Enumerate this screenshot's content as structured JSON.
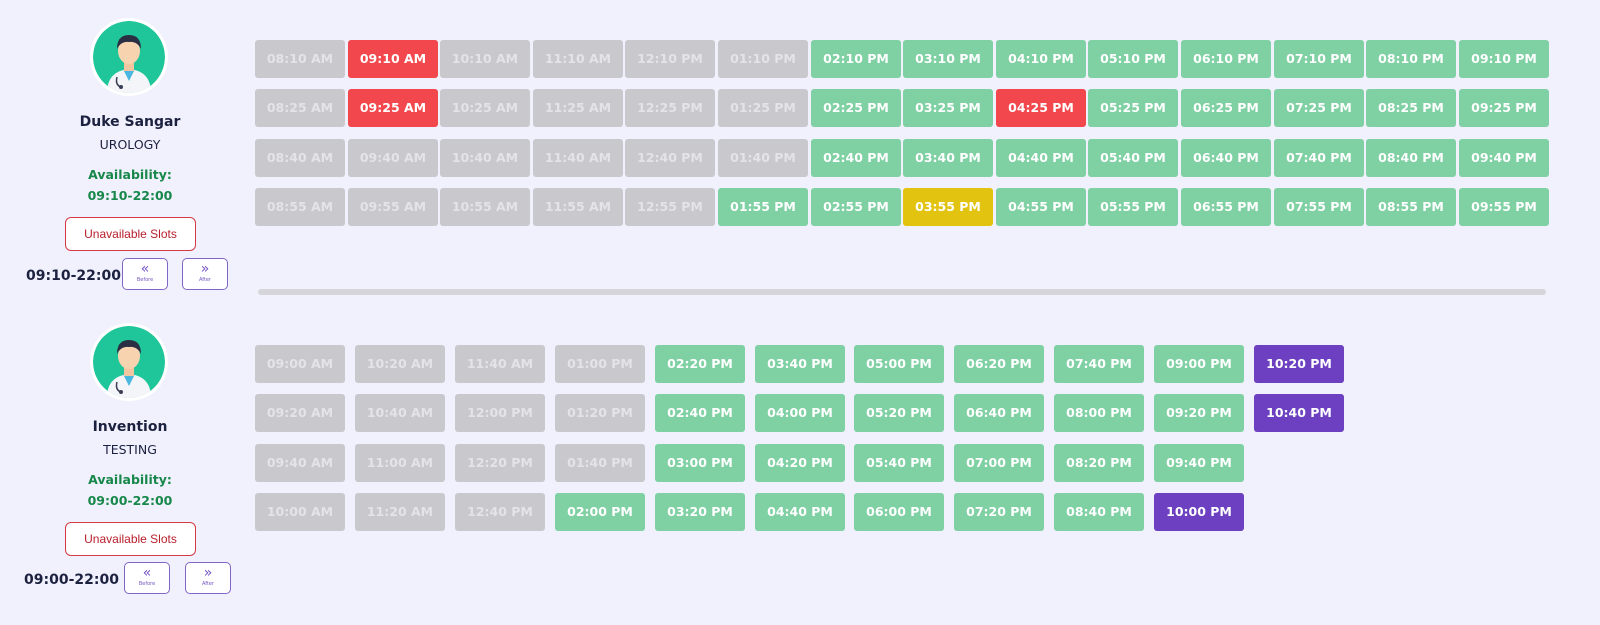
{
  "colors": {
    "past": "#c9c9cd",
    "available": "#7fd0a3",
    "booked": "#f2474d",
    "pending": "#e2c310",
    "special": "#6c40c0",
    "background": "#f0f1fd"
  },
  "doctors": [
    {
      "name": "Duke Sangar",
      "department": "UROLOGY",
      "availability_label": "Availability:",
      "availability_range": "09:10-22:00",
      "unavailable_label": "Unavailable Slots",
      "time_range": "09:10-22:00",
      "before_label": "Before",
      "after_label": "After",
      "slot_rows": [
        [
          [
            "08:10 AM",
            "past"
          ],
          [
            "09:10 AM",
            "booked"
          ],
          [
            "10:10 AM",
            "past"
          ],
          [
            "11:10 AM",
            "past"
          ],
          [
            "12:10 PM",
            "past"
          ],
          [
            "01:10 PM",
            "past"
          ],
          [
            "02:10 PM",
            "open"
          ],
          [
            "03:10 PM",
            "open"
          ],
          [
            "04:10 PM",
            "open"
          ],
          [
            "05:10 PM",
            "open"
          ],
          [
            "06:10 PM",
            "open"
          ],
          [
            "07:10 PM",
            "open"
          ],
          [
            "08:10 PM",
            "open"
          ],
          [
            "09:10 PM",
            "open"
          ]
        ],
        [
          [
            "08:25 AM",
            "past"
          ],
          [
            "09:25 AM",
            "booked"
          ],
          [
            "10:25 AM",
            "past"
          ],
          [
            "11:25 AM",
            "past"
          ],
          [
            "12:25 PM",
            "past"
          ],
          [
            "01:25 PM",
            "past"
          ],
          [
            "02:25 PM",
            "open"
          ],
          [
            "03:25 PM",
            "open"
          ],
          [
            "04:25 PM",
            "booked"
          ],
          [
            "05:25 PM",
            "open"
          ],
          [
            "06:25 PM",
            "open"
          ],
          [
            "07:25 PM",
            "open"
          ],
          [
            "08:25 PM",
            "open"
          ],
          [
            "09:25 PM",
            "open"
          ]
        ],
        [
          [
            "08:40 AM",
            "past"
          ],
          [
            "09:40 AM",
            "past"
          ],
          [
            "10:40 AM",
            "past"
          ],
          [
            "11:40 AM",
            "past"
          ],
          [
            "12:40 PM",
            "past"
          ],
          [
            "01:40 PM",
            "past"
          ],
          [
            "02:40 PM",
            "open"
          ],
          [
            "03:40 PM",
            "open"
          ],
          [
            "04:40 PM",
            "open"
          ],
          [
            "05:40 PM",
            "open"
          ],
          [
            "06:40 PM",
            "open"
          ],
          [
            "07:40 PM",
            "open"
          ],
          [
            "08:40 PM",
            "open"
          ],
          [
            "09:40 PM",
            "open"
          ]
        ],
        [
          [
            "08:55 AM",
            "past"
          ],
          [
            "09:55 AM",
            "past"
          ],
          [
            "10:55 AM",
            "past"
          ],
          [
            "11:55 AM",
            "past"
          ],
          [
            "12:55 PM",
            "past"
          ],
          [
            "01:55 PM",
            "open"
          ],
          [
            "02:55 PM",
            "open"
          ],
          [
            "03:55 PM",
            "pending"
          ],
          [
            "04:55 PM",
            "open"
          ],
          [
            "05:55 PM",
            "open"
          ],
          [
            "06:55 PM",
            "open"
          ],
          [
            "07:55 PM",
            "open"
          ],
          [
            "08:55 PM",
            "open"
          ],
          [
            "09:55 PM",
            "open"
          ]
        ]
      ]
    },
    {
      "name": "Invention",
      "department": "TESTING",
      "availability_label": "Availability:",
      "availability_range": "09:00-22:00",
      "unavailable_label": "Unavailable Slots",
      "time_range": "09:00-22:00",
      "before_label": "Before",
      "after_label": "After",
      "slot_rows": [
        [
          [
            "09:00 AM",
            "past"
          ],
          [
            "10:20 AM",
            "past"
          ],
          [
            "11:40 AM",
            "past"
          ],
          [
            "01:00 PM",
            "past"
          ],
          [
            "02:20 PM",
            "open"
          ],
          [
            "03:40 PM",
            "open"
          ],
          [
            "05:00 PM",
            "open"
          ],
          [
            "06:20 PM",
            "open"
          ],
          [
            "07:40 PM",
            "open"
          ],
          [
            "09:00 PM",
            "open"
          ],
          [
            "10:20 PM",
            "special"
          ]
        ],
        [
          [
            "09:20 AM",
            "past"
          ],
          [
            "10:40 AM",
            "past"
          ],
          [
            "12:00 PM",
            "past"
          ],
          [
            "01:20 PM",
            "past"
          ],
          [
            "02:40 PM",
            "open"
          ],
          [
            "04:00 PM",
            "open"
          ],
          [
            "05:20 PM",
            "open"
          ],
          [
            "06:40 PM",
            "open"
          ],
          [
            "08:00 PM",
            "open"
          ],
          [
            "09:20 PM",
            "open"
          ],
          [
            "10:40 PM",
            "special"
          ]
        ],
        [
          [
            "09:40 AM",
            "past"
          ],
          [
            "11:00 AM",
            "past"
          ],
          [
            "12:20 PM",
            "past"
          ],
          [
            "01:40 PM",
            "past"
          ],
          [
            "03:00 PM",
            "open"
          ],
          [
            "04:20 PM",
            "open"
          ],
          [
            "05:40 PM",
            "open"
          ],
          [
            "07:00 PM",
            "open"
          ],
          [
            "08:20 PM",
            "open"
          ],
          [
            "09:40 PM",
            "open"
          ]
        ],
        [
          [
            "10:00 AM",
            "past"
          ],
          [
            "11:20 AM",
            "past"
          ],
          [
            "12:40 PM",
            "past"
          ],
          [
            "02:00 PM",
            "open"
          ],
          [
            "03:20 PM",
            "open"
          ],
          [
            "04:40 PM",
            "open"
          ],
          [
            "06:00 PM",
            "open"
          ],
          [
            "07:20 PM",
            "open"
          ],
          [
            "08:40 PM",
            "open"
          ],
          [
            "10:00 PM",
            "special"
          ]
        ]
      ]
    }
  ]
}
